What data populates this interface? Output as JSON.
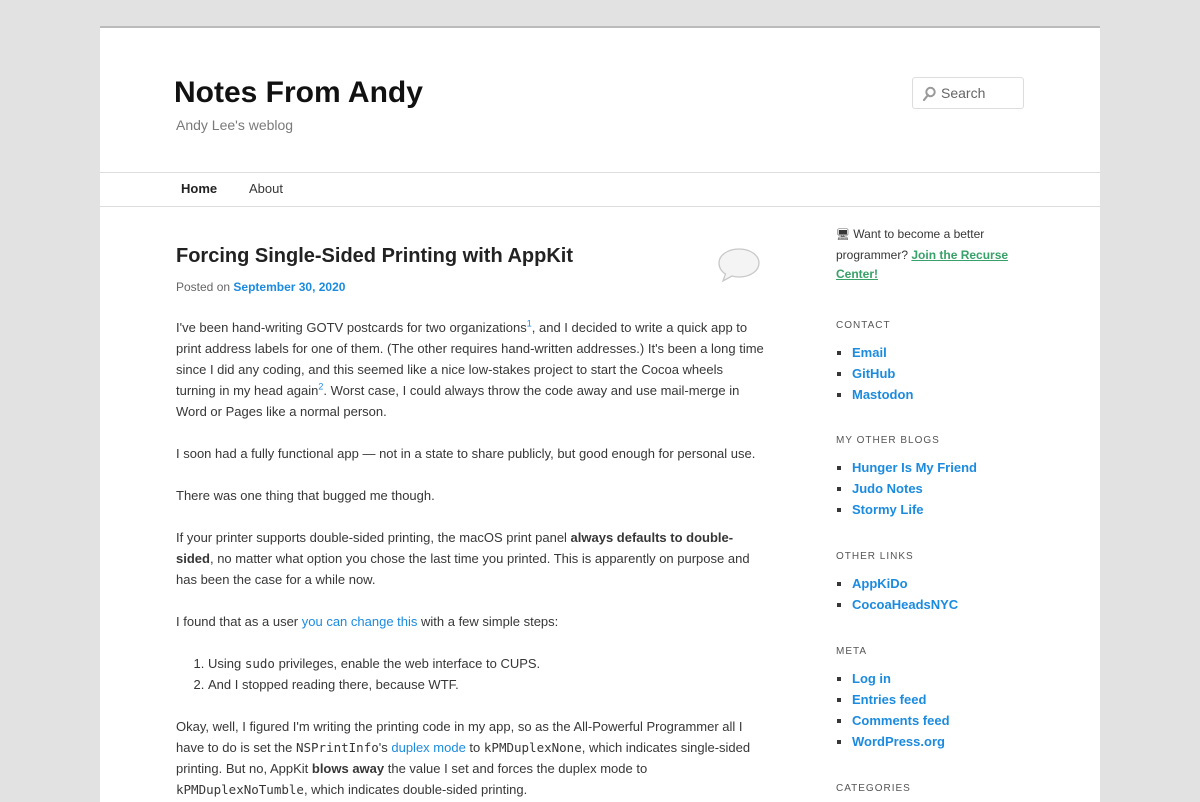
{
  "site": {
    "title": "Notes From Andy",
    "description": "Andy Lee's weblog"
  },
  "search": {
    "placeholder": "Search",
    "icon": "search-icon"
  },
  "nav": {
    "items": [
      {
        "label": "Home"
      },
      {
        "label": "About"
      }
    ]
  },
  "post": {
    "title": "Forcing Single-Sided Printing with AppKit",
    "posted_on": "Posted on",
    "date": "September 30, 2020",
    "comment_icon": "comment-bubble-icon",
    "p1_a": "I've been hand-writing GOTV postcards for two organizations",
    "fn1": "1",
    "p1_b": ", and I decided to write a quick app to print address labels for one of them. (The other requires hand-written addresses.) It's been a long time since I did any coding, and this seemed like a nice low-stakes project to start the Cocoa wheels turning in my head again",
    "fn2": "2",
    "p1_c": ". Worst case, I could always throw the code away and use mail-merge in Word or Pages like a normal person.",
    "p2": "I soon had a fully functional app — not in a state to share publicly, but good enough for personal use.",
    "p3": "There was one thing that bugged me though.",
    "p4_a": "If your printer supports double-sided printing, the macOS print panel ",
    "p4_b": "always defaults to double-sided",
    "p4_c": ", no matter what option you chose the last time you printed. This is apparently on purpose and has been the case for a while now.",
    "p5_a": "I found that as a user ",
    "p5_link": "you can change this",
    "p5_b": " with a few simple steps:",
    "step1_a": "Using ",
    "step1_code": "sudo",
    "step1_b": " privileges, enable the web interface to CUPS.",
    "step2": "And I stopped reading there, because WTF.",
    "p6_a": "Okay, well, I figured I'm writing the printing code in my app, so as the All-Powerful Programmer all I have to do is set the ",
    "p6_code1": "NSPrintInfo",
    "p6_b": "'s ",
    "p6_link": "duplex mode",
    "p6_c": " to ",
    "p6_code2": "kPMDuplexNone",
    "p6_d": ", which indicates single-sided printing. But no, AppKit ",
    "p6_bold": "blows away",
    "p6_e": " the value I set and forces the duplex mode to ",
    "p6_code3": "kPMDuplexNoTumble",
    "p6_f": ", which indicates double-sided printing."
  },
  "sidebar": {
    "promo_icon": "🖥",
    "promo_text": " Want to become a better programmer? ",
    "promo_link": "Join the Recurse Center!",
    "contact": {
      "title": "CONTACT",
      "items": [
        "Email",
        "GitHub",
        "Mastodon"
      ]
    },
    "blogs": {
      "title": "MY OTHER BLOGS",
      "items": [
        "Hunger Is My Friend",
        "Judo Notes",
        "Stormy Life"
      ]
    },
    "links": {
      "title": "OTHER LINKS",
      "items": [
        "AppKiDo",
        "CocoaHeadsNYC"
      ]
    },
    "meta": {
      "title": "META",
      "items": [
        "Log in",
        "Entries feed",
        "Comments feed",
        "WordPress.org"
      ]
    },
    "categories": {
      "title": "CATEGORIES"
    }
  }
}
